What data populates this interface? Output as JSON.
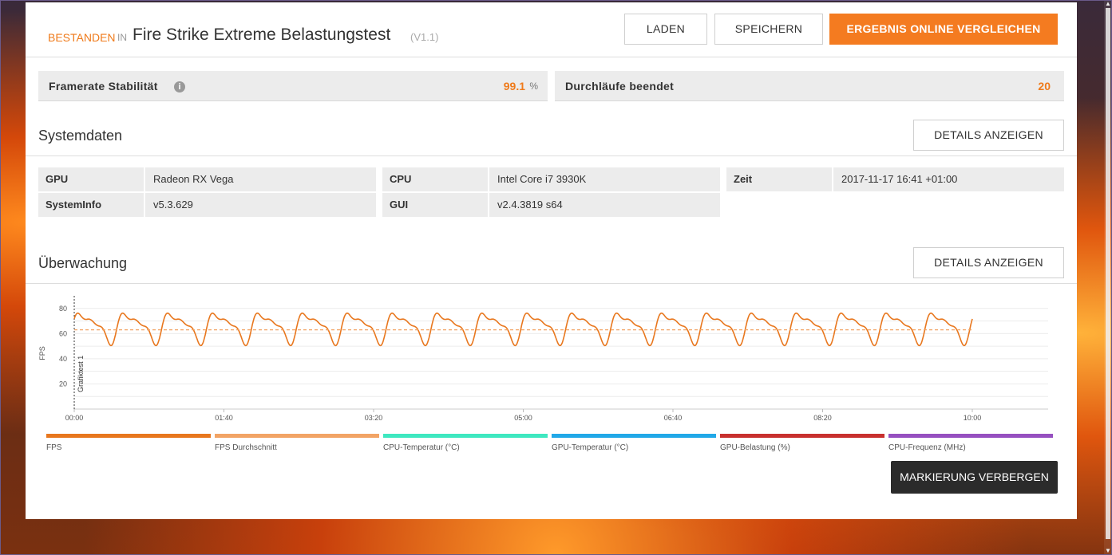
{
  "header": {
    "status": "BESTANDEN",
    "in_word": "IN",
    "test_name": "Fire Strike Extreme Belastungstest",
    "version": "(V1.1)",
    "load_label": "LADEN",
    "save_label": "SPEICHERN",
    "compare_label": "ERGEBNIS ONLINE VERGLEICHEN"
  },
  "stats": {
    "stability_label": "Framerate Stabilität",
    "stability_value": "99.1",
    "stability_unit": "%",
    "loops_label": "Durchläufe beendet",
    "loops_value": "20"
  },
  "system": {
    "title": "Systemdaten",
    "details_label": "DETAILS ANZEIGEN",
    "gpu_key": "GPU",
    "gpu_val": "Radeon RX Vega",
    "cpu_key": "CPU",
    "cpu_val": "Intel Core i7 3930K",
    "time_key": "Zeit",
    "time_val": "2017-11-17 16:41 +01:00",
    "sysinfo_key": "SystemInfo",
    "sysinfo_val": "v5.3.629",
    "gui_key": "GUI",
    "gui_val": "v2.4.3819 s64"
  },
  "monitoring": {
    "title": "Überwachung",
    "details_label": "DETAILS ANZEIGEN",
    "marker_label": "MARKIERUNG VERBERGEN",
    "legend": [
      {
        "label": "FPS",
        "color": "#e8771e"
      },
      {
        "label": "FPS Durchschnitt",
        "color": "#f2a465"
      },
      {
        "label": "CPU-Temperatur (°C)",
        "color": "#3ee8c0"
      },
      {
        "label": "GPU-Temperatur (°C)",
        "color": "#21a8e8"
      },
      {
        "label": "GPU-Belastung (%)",
        "color": "#c8302e"
      },
      {
        "label": "CPU-Frequenz (MHz)",
        "color": "#9650c0"
      }
    ]
  },
  "chart_data": {
    "type": "line",
    "ylabel": "FPS",
    "ylim": [
      0,
      90
    ],
    "yticks": [
      20,
      40,
      60,
      80
    ],
    "xticks": [
      "00:00",
      "01:40",
      "03:20",
      "05:00",
      "06:40",
      "08:20",
      "10:00"
    ],
    "x_range_seconds": [
      0,
      600
    ],
    "marker": {
      "label": "Grafiktest 1",
      "x": "00:00"
    },
    "series": [
      {
        "name": "FPS",
        "pattern": "oscillating",
        "min": 50,
        "max": 82,
        "period_seconds": 30,
        "color": "#e8771e"
      },
      {
        "name": "FPS Durchschnitt",
        "value": 63,
        "style": "dashed",
        "color": "#f2a465"
      }
    ],
    "grid": true
  }
}
